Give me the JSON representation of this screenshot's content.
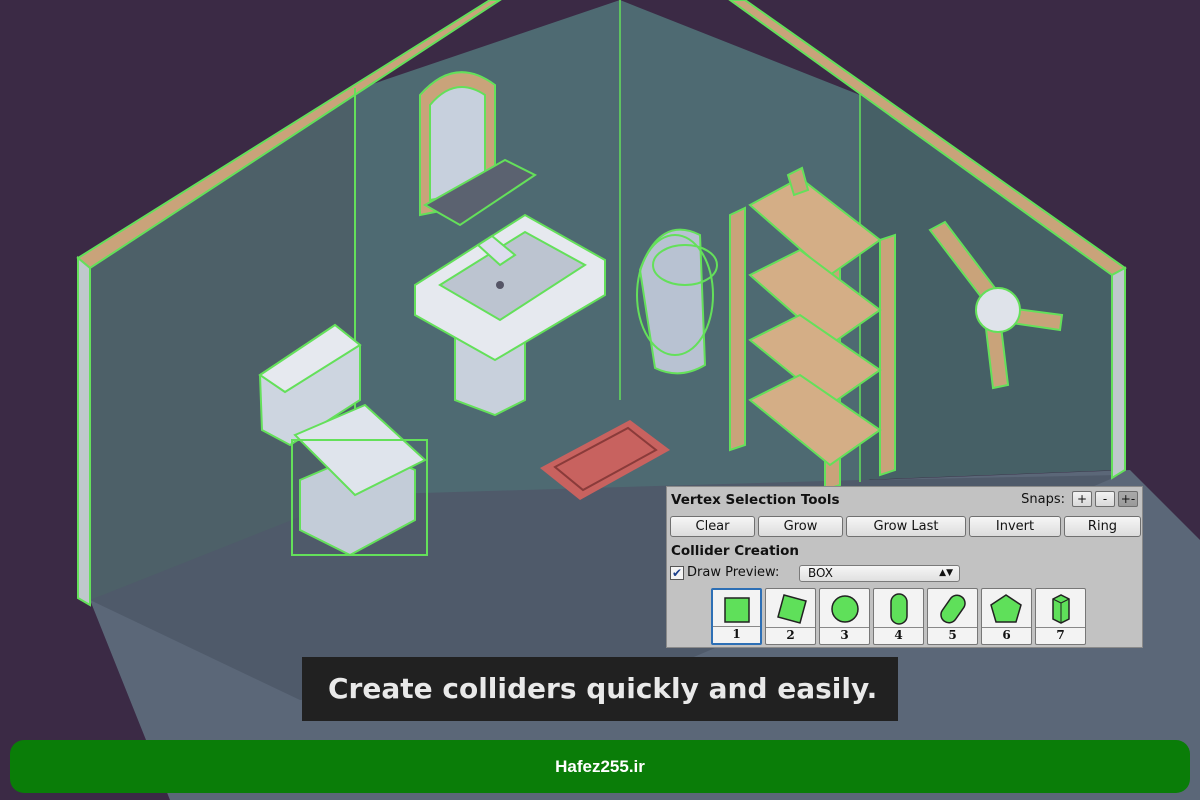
{
  "scene": {
    "description_icons": [
      "toilet",
      "sink",
      "mirror",
      "trash-can",
      "shelf",
      "fan",
      "rug"
    ],
    "colors": {
      "background": "#3b2a45",
      "wall": "#4a5d66",
      "floor": "#556171",
      "wall_edge": "#c9a37a",
      "collider_outline": "#64e05a"
    }
  },
  "panel": {
    "title": "Vertex Selection Tools",
    "snaps_label": "Snaps:",
    "snap_buttons": [
      "+",
      "-",
      "+-"
    ],
    "buttons": [
      "Clear",
      "Grow",
      "Grow Last",
      "Invert",
      "Ring"
    ],
    "collider_title": "Collider Creation",
    "draw_preview_checked": true,
    "draw_preview_label": "Draw Preview:",
    "shape_select": "BOX",
    "shapes": [
      {
        "num": "1",
        "icon": "square-icon"
      },
      {
        "num": "2",
        "icon": "rotated-square-icon"
      },
      {
        "num": "3",
        "icon": "circle-icon"
      },
      {
        "num": "4",
        "icon": "capsule-icon"
      },
      {
        "num": "5",
        "icon": "tilted-capsule-icon"
      },
      {
        "num": "6",
        "icon": "pentagon-icon"
      },
      {
        "num": "7",
        "icon": "cylinder-icon"
      }
    ],
    "selected_shape": "1",
    "shape_fill": "#5fe05a"
  },
  "caption": "Create colliders quickly and easily.",
  "footer": "Hafez255.ir"
}
